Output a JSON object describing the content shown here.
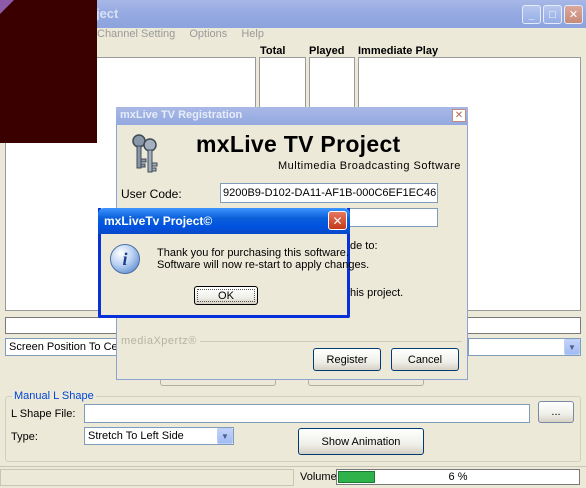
{
  "main_window": {
    "title": "oject",
    "menu": [
      "Channel Setting",
      "Options",
      "Help"
    ],
    "columns": [
      "Total",
      "Played",
      "Immediate Play"
    ],
    "screen_position": "Screen Position To Centre",
    "manual_l_shape": {
      "legend": "Manual L Shape",
      "file_label": "L Shape File:",
      "file_value": "",
      "browse_label": "...",
      "type_label": "Type:",
      "type_value": "Stretch To Left Side",
      "show_animation_label": "Show Animation"
    },
    "status": {
      "volume_label": "Volume:",
      "volume_value": "6 %",
      "volume_fraction": 0.06
    }
  },
  "registration_dialog": {
    "title": "mxLive TV Registration",
    "heading": "mxLive TV Project",
    "subheading": "Multimedia Broadcasting Software",
    "user_code_label": "User Code:",
    "user_code_value": "9200B9-D102-DA11-AF1B-000C6EF1EC46",
    "partial_text_1": "de to:",
    "partial_text_2": "his project.",
    "company_watermark": "mediaXpertz®",
    "register_label": "Register",
    "cancel_label": "Cancel"
  },
  "message_box": {
    "title": "mxLiveTv Project©",
    "line1": "Thank you for purchasing this software.",
    "line2": "Software will now re-start to apply changes.",
    "ok_label": "OK",
    "icon": "info-icon"
  }
}
